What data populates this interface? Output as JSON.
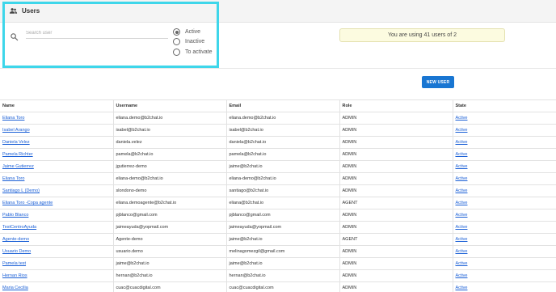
{
  "header": {
    "title": "Users"
  },
  "search": {
    "placeholder": "Search user",
    "value": ""
  },
  "status_filter": {
    "selected": "Active",
    "options": [
      {
        "label": "Active",
        "checked": true
      },
      {
        "label": "Inactive",
        "checked": false
      },
      {
        "label": "To activate",
        "checked": false
      }
    ]
  },
  "usage": {
    "text": "You are using 41 users of 2"
  },
  "actions": {
    "new_user_label": "NEW USER",
    "accent": "#1976d2"
  },
  "highlight_color": "#3ed6ea",
  "table": {
    "columns": [
      "Name",
      "Username",
      "Email",
      "Role",
      "State"
    ],
    "rows": [
      [
        "Eliana Toro",
        "eliana.demo@b2chat.io",
        "eliana.demo@b2chat.io",
        "ADMIN",
        "Active"
      ],
      [
        "Isabel Arango",
        "isabel@b2chat.io",
        "isabel@b2chat.io",
        "ADMIN",
        "Active"
      ],
      [
        "Daniela Velez",
        "daniela.velez",
        "daniela@b2chat.io",
        "ADMIN",
        "Active"
      ],
      [
        "Pamela Richter",
        "pamela@b2chat.io",
        "pamela@b2chat.io",
        "ADMIN",
        "Active"
      ],
      [
        "Jaime Gutierrez",
        "jgutierrez-demo",
        "jaime@b2chat.io",
        "ADMIN",
        "Active"
      ],
      [
        "Eliana Toro",
        "eliana-demo@b2chat.io",
        "eliana-demo@b2chat.io",
        "ADMIN",
        "Active"
      ],
      [
        "Santiago L (Demo)",
        "slondono-demo",
        "santiago@b2chat.io",
        "ADMIN",
        "Active"
      ],
      [
        "Eliana Toro -Copa agente",
        "eliana.demoagente@b2chat.io",
        "eliana@b2chat.io",
        "AGENT",
        "Active"
      ],
      [
        "Pablo Blanco",
        "pjblanco@gmail.com",
        "pjblanco@gmail.com",
        "ADMIN",
        "Active"
      ],
      [
        "TestCentroAyuda",
        "jaimeayuda@yopmail.com",
        "jaimeayuda@yopmail.com",
        "ADMIN",
        "Active"
      ],
      [
        "Agente-demo",
        "Agente-demo",
        "jaime@b2chat.io",
        "AGENT",
        "Active"
      ],
      [
        "Usuario Demo",
        "usuario.demo",
        "melinagomezgil@gmail.com",
        "ADMIN",
        "Active"
      ],
      [
        "Pamela test",
        "jaime@b2chat.io",
        "jaime@b2chat.io",
        "ADMIN",
        "Active"
      ],
      [
        "Hernan Rios",
        "hernan@b2chat.io",
        "hernan@b2chat.io",
        "ADMIN",
        "Active"
      ],
      [
        "Maria Cecilia",
        "cuac@cuacdigital.com",
        "cuac@cuacdigital.com",
        "ADMIN",
        "Active"
      ]
    ]
  }
}
